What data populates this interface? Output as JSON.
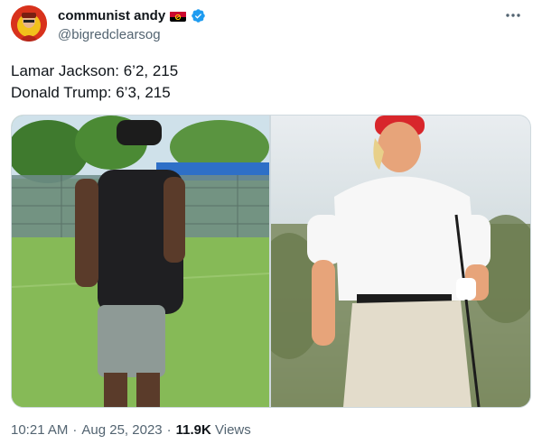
{
  "author": {
    "display_name": "communist andy",
    "handle": "@bigredclearsog",
    "flag_icon": "angola-flag-icon",
    "verified_icon": "verified-badge-icon",
    "verified_color": "#1d9bf0"
  },
  "tweet": {
    "lines": [
      "Lamar Jackson: 6’2, 215",
      "Donald Trump: 6’3, 215"
    ]
  },
  "media": {
    "photos": [
      {
        "icon": "photo-football-player"
      },
      {
        "icon": "photo-golfer"
      }
    ]
  },
  "meta": {
    "time": "10:21 AM",
    "separator1": "·",
    "date": "Aug 25, 2023",
    "separator2": "·",
    "views_count": "11.9K",
    "views_label": "Views"
  },
  "colors": {
    "text": "#0f1419",
    "secondary": "#536471",
    "border": "#cfd9de"
  }
}
